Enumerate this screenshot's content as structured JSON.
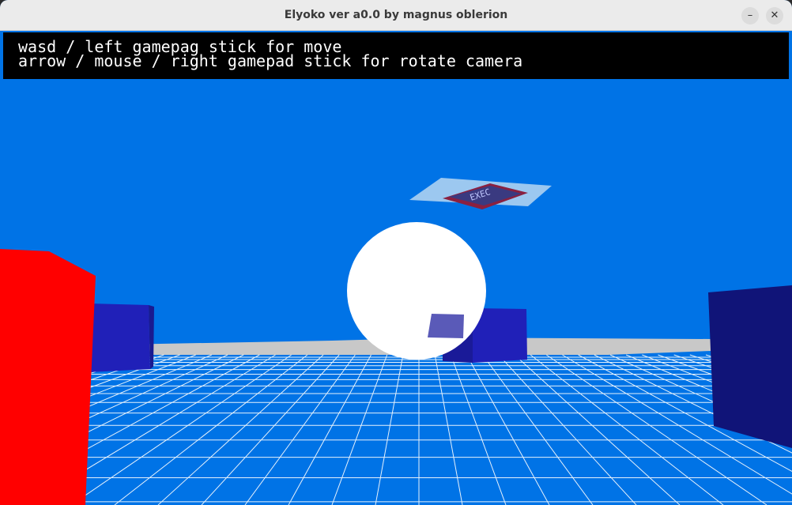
{
  "window": {
    "title": "Elyoko ver a0.0 by magnus oblerion",
    "minimize_glyph": "–",
    "close_glyph": "✕"
  },
  "hud": {
    "line1": "wasd / left gamepag stick for move",
    "line2": "arrow / mouse / right gamepad stick for rotate camera"
  },
  "scene": {
    "sky_color": "#0073e6",
    "floor_color": "#0073e6",
    "grid_color": "#ffffff",
    "horizon_band_color": "#c8c8c8",
    "sphere_color": "#ffffff",
    "red_cube_color": "#ff0000",
    "blue_cube_color": "#2020b8",
    "dark_cube_color": "#101478",
    "sign_label": "EXEC"
  }
}
